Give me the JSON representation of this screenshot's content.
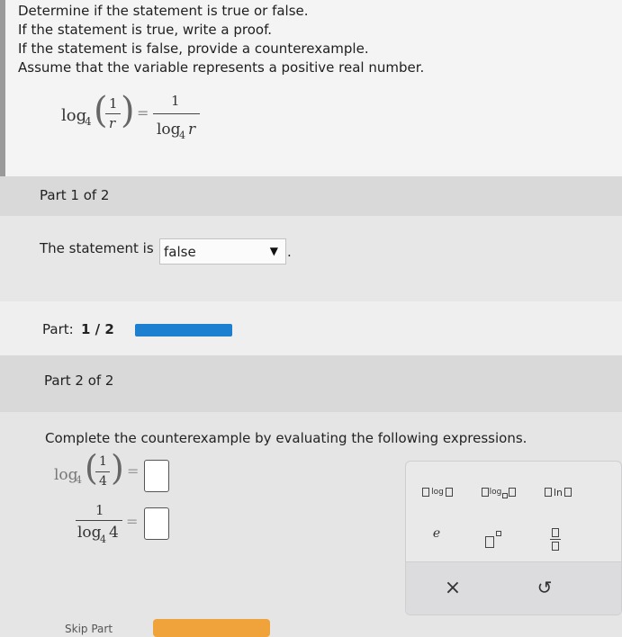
{
  "problem": {
    "lines": [
      "Determine if the statement is true or false.",
      "If the statement is true, write a proof.",
      "If the statement is false, provide a counterexample.",
      "Assume that the variable represents a positive real number."
    ],
    "equation": {
      "log": "log",
      "base": "4",
      "num1": "1",
      "den1": "r",
      "equals": "=",
      "num2": "1",
      "den2_log": "log",
      "den2_base": "4",
      "den2_var": "r"
    }
  },
  "part1": {
    "title": "Part 1 of 2",
    "prompt": "The statement is",
    "selected": "false",
    "period": "."
  },
  "progress": {
    "label": "Part:",
    "value": "1 / 2",
    "fraction": 0.5
  },
  "part2": {
    "title": "Part 2 of 2",
    "instruction": "Complete the counterexample by evaluating the following expressions.",
    "expr1": {
      "log": "log",
      "base": "4",
      "num": "1",
      "den": "4",
      "equals": "="
    },
    "expr2": {
      "num": "1",
      "den_log": "log",
      "den_base": "4",
      "den_arg": "4",
      "equals": "="
    }
  },
  "palette": {
    "log_label": "log",
    "logsub_label": "log",
    "ln_label": "ln",
    "e_label": "e",
    "clear_symbol": "×",
    "undo_symbol": "↺"
  },
  "footer": {
    "skip_label": "Skip Part"
  },
  "colors": {
    "progress_fill": "#1c7fd0",
    "check_button": "#f0a23b"
  }
}
